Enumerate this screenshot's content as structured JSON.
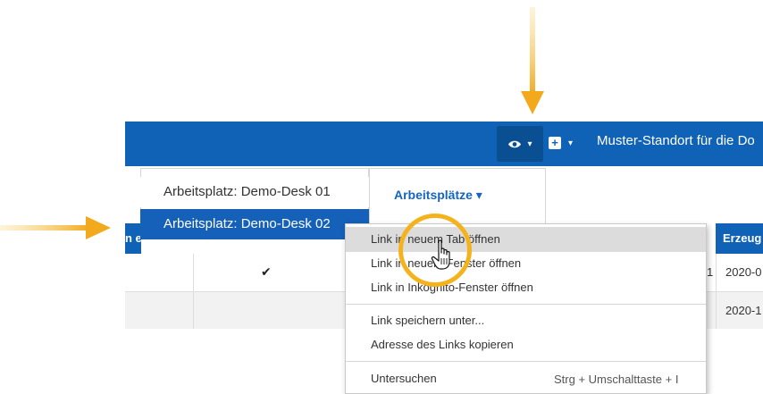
{
  "header": {
    "title": "Muster-Standort für die Do",
    "eye_icon": "eye-icon",
    "plus_icon": "plus-square-icon",
    "caret": "▾"
  },
  "tabs": {
    "active_label": "Arbeitsplätze ▾",
    "workspace_items": [
      {
        "label": "Arbeitsplatz: Demo-Desk 01",
        "selected": false
      },
      {
        "label": "Arbeitsplatz: Demo-Desk 02",
        "selected": true
      }
    ]
  },
  "table": {
    "header_left": "n e",
    "header_right": "Erzeug",
    "rows": [
      {
        "check": "✔",
        "partial_right": "1",
        "date": "2020-0"
      },
      {
        "check": "",
        "partial_right": "",
        "date": "2020-1"
      }
    ]
  },
  "context_menu": {
    "items": [
      {
        "label": "Link in neuem Tab öffnen",
        "highlighted": true
      },
      {
        "label": "Link in neuem Fenster öffnen"
      },
      {
        "label": "Link in Inkognito-Fenster öffnen"
      },
      {
        "label": "Link speichern unter..."
      },
      {
        "label": "Adresse des Links kopieren"
      },
      {
        "label": "Untersuchen",
        "shortcut": "Strg + Umschalttaste + I"
      }
    ]
  },
  "colors": {
    "brand_blue": "#0f62b6",
    "highlight": "#f4b21d",
    "selection": "#1560b8"
  }
}
